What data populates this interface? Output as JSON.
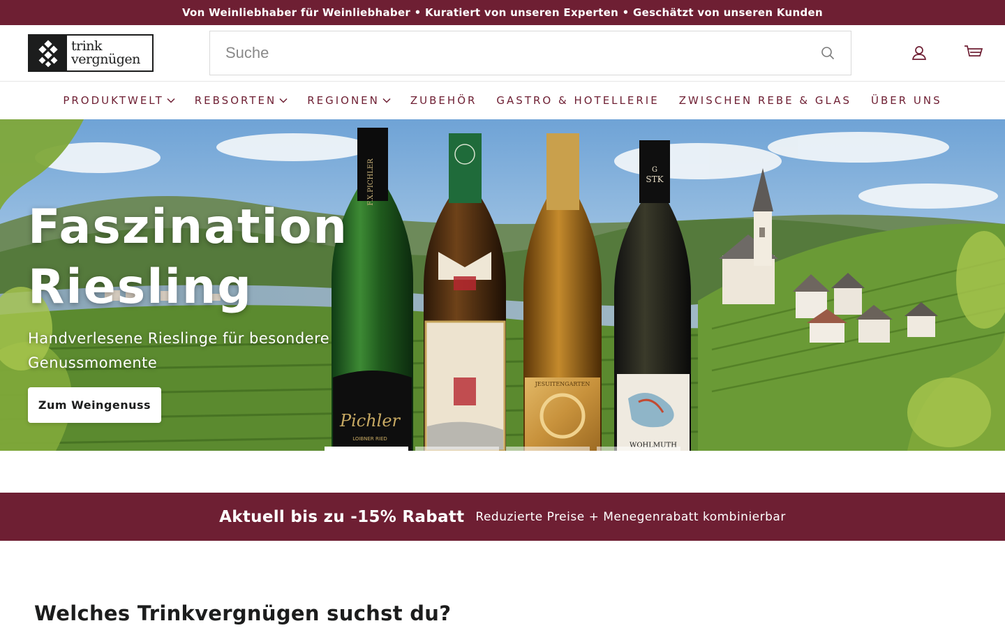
{
  "announcement": {
    "text": "Von Weinliebhaber für Weinliebhaber • Kuratiert von unseren Experten • Geschätzt von unseren Kunden"
  },
  "header": {
    "logo": {
      "line1": "trink",
      "line2": "vergnügen"
    },
    "search": {
      "placeholder": "Suche",
      "value": ""
    },
    "icons": {
      "search": "search-icon",
      "account": "user-icon",
      "cart": "cart-icon"
    }
  },
  "nav": {
    "items": [
      {
        "label": "PRODUKTWELT",
        "has_dropdown": true
      },
      {
        "label": "REBSORTEN",
        "has_dropdown": true
      },
      {
        "label": "REGIONEN",
        "has_dropdown": true
      },
      {
        "label": "ZUBEHÖR",
        "has_dropdown": false
      },
      {
        "label": "GASTRO & HOTELLERIE",
        "has_dropdown": false
      },
      {
        "label": "ZWISCHEN REBE & GLAS",
        "has_dropdown": false
      },
      {
        "label": "ÜBER UNS",
        "has_dropdown": false
      }
    ]
  },
  "hero": {
    "title_line1": "Faszination",
    "title_line2": "Riesling",
    "subtitle": "Handverlesene Rieslinge für besondere Genussmomente",
    "cta": "Zum Weingenuss",
    "slides_total": 4,
    "active_slide": 1,
    "bottle_labels": {
      "b1_neck": "F.X.PICHLER",
      "b1_label": "Pichler",
      "b1_small": "LOIBNER RIED",
      "b4_neck1": "G",
      "b4_neck2": "STK",
      "b4_label": "WOHLMUTH",
      "b3_label": "JESUITENGARTEN"
    }
  },
  "promo": {
    "title": "Aktuell bis zu -15% Rabatt",
    "text": "Reduzierte Preise + Menegenrabatt kombinierbar"
  },
  "section": {
    "title": "Welches Trinkvergnügen suchst du?"
  },
  "colors": {
    "brand": "#6e1f33",
    "text": "#1c1d1d",
    "white": "#ffffff"
  }
}
